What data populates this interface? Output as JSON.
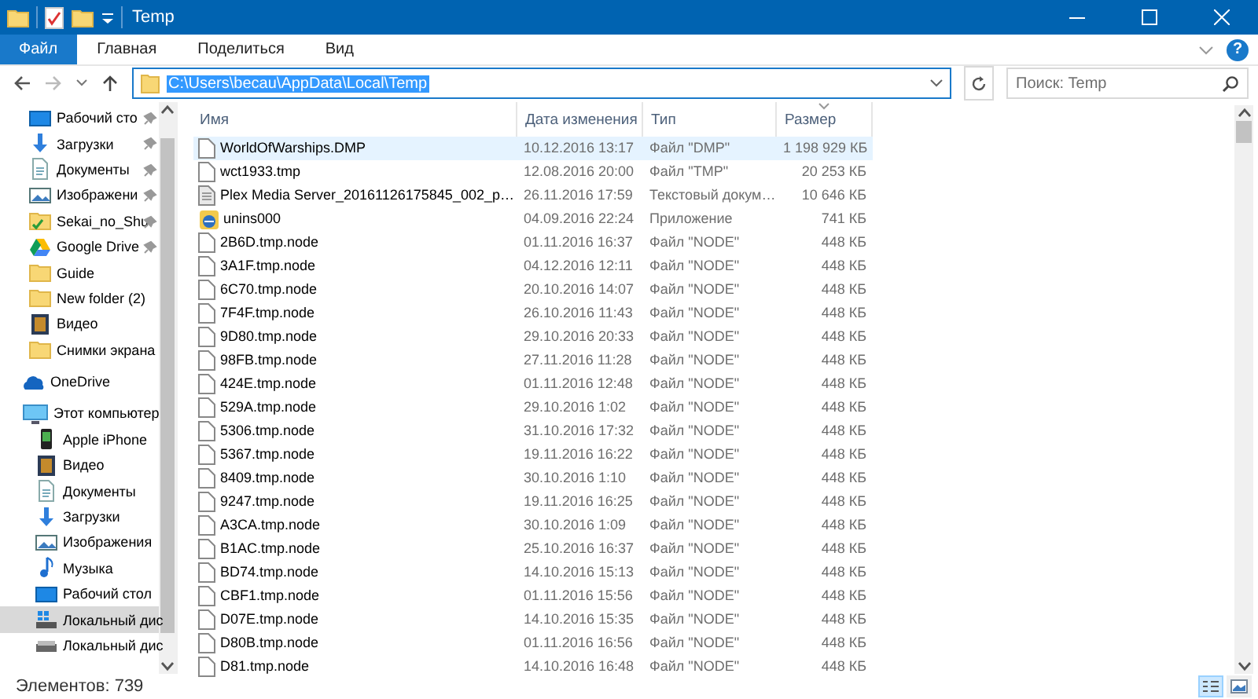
{
  "window": {
    "title": "Temp"
  },
  "ribbon_tabs": [
    {
      "label": "Файл",
      "kind": "file",
      "selected": false
    },
    {
      "label": "Главная",
      "kind": "tab",
      "selected": false
    },
    {
      "label": "Поделиться",
      "kind": "tab",
      "selected": false
    },
    {
      "label": "Вид",
      "kind": "tab",
      "selected": false
    }
  ],
  "help_button": {
    "label": "?"
  },
  "address": {
    "path": "C:\\Users\\becau\\AppData\\Local\\Temp",
    "selected": true
  },
  "search": {
    "placeholder": "Поиск: Temp"
  },
  "sidebar": {
    "quick_access": [
      {
        "label": "Рабочий сто",
        "kind": "desktop",
        "pinned": true,
        "selected": false
      },
      {
        "label": "Загрузки",
        "kind": "downloads",
        "pinned": true,
        "selected": false
      },
      {
        "label": "Документы",
        "kind": "documents",
        "pinned": true,
        "selected": false
      },
      {
        "label": "Изображени",
        "kind": "pictures",
        "pinned": true,
        "selected": false
      },
      {
        "label": "Sekai_no_Shu",
        "kind": "sync",
        "pinned": true,
        "selected": false
      },
      {
        "label": "Google Drive",
        "kind": "gdrive",
        "pinned": true,
        "selected": false
      },
      {
        "label": "Guide",
        "kind": "folder",
        "pinned": false,
        "selected": false
      },
      {
        "label": "New folder (2)",
        "kind": "folder",
        "pinned": false,
        "selected": false
      },
      {
        "label": "Видео",
        "kind": "video",
        "pinned": false,
        "selected": false
      },
      {
        "label": "Снимки экрана",
        "kind": "folder",
        "pinned": false,
        "selected": false
      }
    ],
    "tree": [
      {
        "label": "OneDrive",
        "kind": "onedrive",
        "selected": false
      },
      {
        "label": "Этот компьютер",
        "kind": "computer",
        "selected": false,
        "children": [
          {
            "label": "Apple iPhone",
            "kind": "phone",
            "selected": false
          },
          {
            "label": "Видео",
            "kind": "video",
            "selected": false
          },
          {
            "label": "Документы",
            "kind": "documents",
            "selected": false
          },
          {
            "label": "Загрузки",
            "kind": "downloads",
            "selected": false
          },
          {
            "label": "Изображения",
            "kind": "pictures",
            "selected": false
          },
          {
            "label": "Музыка",
            "kind": "music",
            "selected": false
          },
          {
            "label": "Рабочий стол",
            "kind": "desktop",
            "selected": false
          },
          {
            "label": "Локальный дис",
            "kind": "windrive",
            "selected": true
          },
          {
            "label": "Локальный дис",
            "kind": "drive",
            "selected": false
          }
        ]
      }
    ]
  },
  "table": {
    "columns": [
      {
        "label": "Имя",
        "sorted": false
      },
      {
        "label": "Дата изменения",
        "sorted": false
      },
      {
        "label": "Тип",
        "sorted": false
      },
      {
        "label": "Размер",
        "sorted": true
      }
    ],
    "rows": [
      {
        "kind": "file",
        "name": "WorldOfWarships.DMP",
        "date": "10.12.2016 13:17",
        "type": "Файл \"DMP\"",
        "size": "1 198 929 КБ",
        "selected": true
      },
      {
        "kind": "file",
        "name": "wct1933.tmp",
        "date": "12.08.2016 20:00",
        "type": "Файл \"TMP\"",
        "size": "20 253 КБ",
        "selected": false
      },
      {
        "kind": "text",
        "name": "Plex Media Server_20161126175845_002_p…",
        "date": "26.11.2016 17:59",
        "type": "Текстовый докум…",
        "size": "10 646 КБ",
        "selected": false
      },
      {
        "kind": "app",
        "name": "unins000",
        "date": "04.09.2016 22:24",
        "type": "Приложение",
        "size": "741 КБ",
        "selected": false
      },
      {
        "kind": "file",
        "name": "2B6D.tmp.node",
        "date": "01.11.2016 16:37",
        "type": "Файл \"NODE\"",
        "size": "448 КБ",
        "selected": false
      },
      {
        "kind": "file",
        "name": "3A1F.tmp.node",
        "date": "04.12.2016 12:11",
        "type": "Файл \"NODE\"",
        "size": "448 КБ",
        "selected": false
      },
      {
        "kind": "file",
        "name": "6C70.tmp.node",
        "date": "20.10.2016 14:07",
        "type": "Файл \"NODE\"",
        "size": "448 КБ",
        "selected": false
      },
      {
        "kind": "file",
        "name": "7F4F.tmp.node",
        "date": "26.10.2016 11:43",
        "type": "Файл \"NODE\"",
        "size": "448 КБ",
        "selected": false
      },
      {
        "kind": "file",
        "name": "9D80.tmp.node",
        "date": "29.10.2016 20:33",
        "type": "Файл \"NODE\"",
        "size": "448 КБ",
        "selected": false
      },
      {
        "kind": "file",
        "name": "98FB.tmp.node",
        "date": "27.11.2016 11:28",
        "type": "Файл \"NODE\"",
        "size": "448 КБ",
        "selected": false
      },
      {
        "kind": "file",
        "name": "424E.tmp.node",
        "date": "01.11.2016 12:48",
        "type": "Файл \"NODE\"",
        "size": "448 КБ",
        "selected": false
      },
      {
        "kind": "file",
        "name": "529A.tmp.node",
        "date": "29.10.2016 1:02",
        "type": "Файл \"NODE\"",
        "size": "448 КБ",
        "selected": false
      },
      {
        "kind": "file",
        "name": "5306.tmp.node",
        "date": "31.10.2016 17:32",
        "type": "Файл \"NODE\"",
        "size": "448 КБ",
        "selected": false
      },
      {
        "kind": "file",
        "name": "5367.tmp.node",
        "date": "19.11.2016 16:22",
        "type": "Файл \"NODE\"",
        "size": "448 КБ",
        "selected": false
      },
      {
        "kind": "file",
        "name": "8409.tmp.node",
        "date": "30.10.2016 1:10",
        "type": "Файл \"NODE\"",
        "size": "448 КБ",
        "selected": false
      },
      {
        "kind": "file",
        "name": "9247.tmp.node",
        "date": "19.11.2016 16:25",
        "type": "Файл \"NODE\"",
        "size": "448 КБ",
        "selected": false
      },
      {
        "kind": "file",
        "name": "A3CA.tmp.node",
        "date": "30.10.2016 1:09",
        "type": "Файл \"NODE\"",
        "size": "448 КБ",
        "selected": false
      },
      {
        "kind": "file",
        "name": "B1AC.tmp.node",
        "date": "25.10.2016 16:37",
        "type": "Файл \"NODE\"",
        "size": "448 КБ",
        "selected": false
      },
      {
        "kind": "file",
        "name": "BD74.tmp.node",
        "date": "14.10.2016 15:13",
        "type": "Файл \"NODE\"",
        "size": "448 КБ",
        "selected": false
      },
      {
        "kind": "file",
        "name": "CBF1.tmp.node",
        "date": "01.11.2016 15:56",
        "type": "Файл \"NODE\"",
        "size": "448 КБ",
        "selected": false
      },
      {
        "kind": "file",
        "name": "D07E.tmp.node",
        "date": "14.10.2016 15:35",
        "type": "Файл \"NODE\"",
        "size": "448 КБ",
        "selected": false
      },
      {
        "kind": "file",
        "name": "D80B.tmp.node",
        "date": "01.11.2016 16:56",
        "type": "Файл \"NODE\"",
        "size": "448 КБ",
        "selected": false
      },
      {
        "kind": "file",
        "name": "D81.tmp.node",
        "date": "14.10.2016 16:48",
        "type": "Файл \"NODE\"",
        "size": "448 КБ",
        "selected": false
      }
    ]
  },
  "status_bar": {
    "count": "Элементов: 739",
    "views": [
      {
        "kind": "details",
        "selected": true
      },
      {
        "kind": "large-icons",
        "selected": false
      }
    ]
  }
}
